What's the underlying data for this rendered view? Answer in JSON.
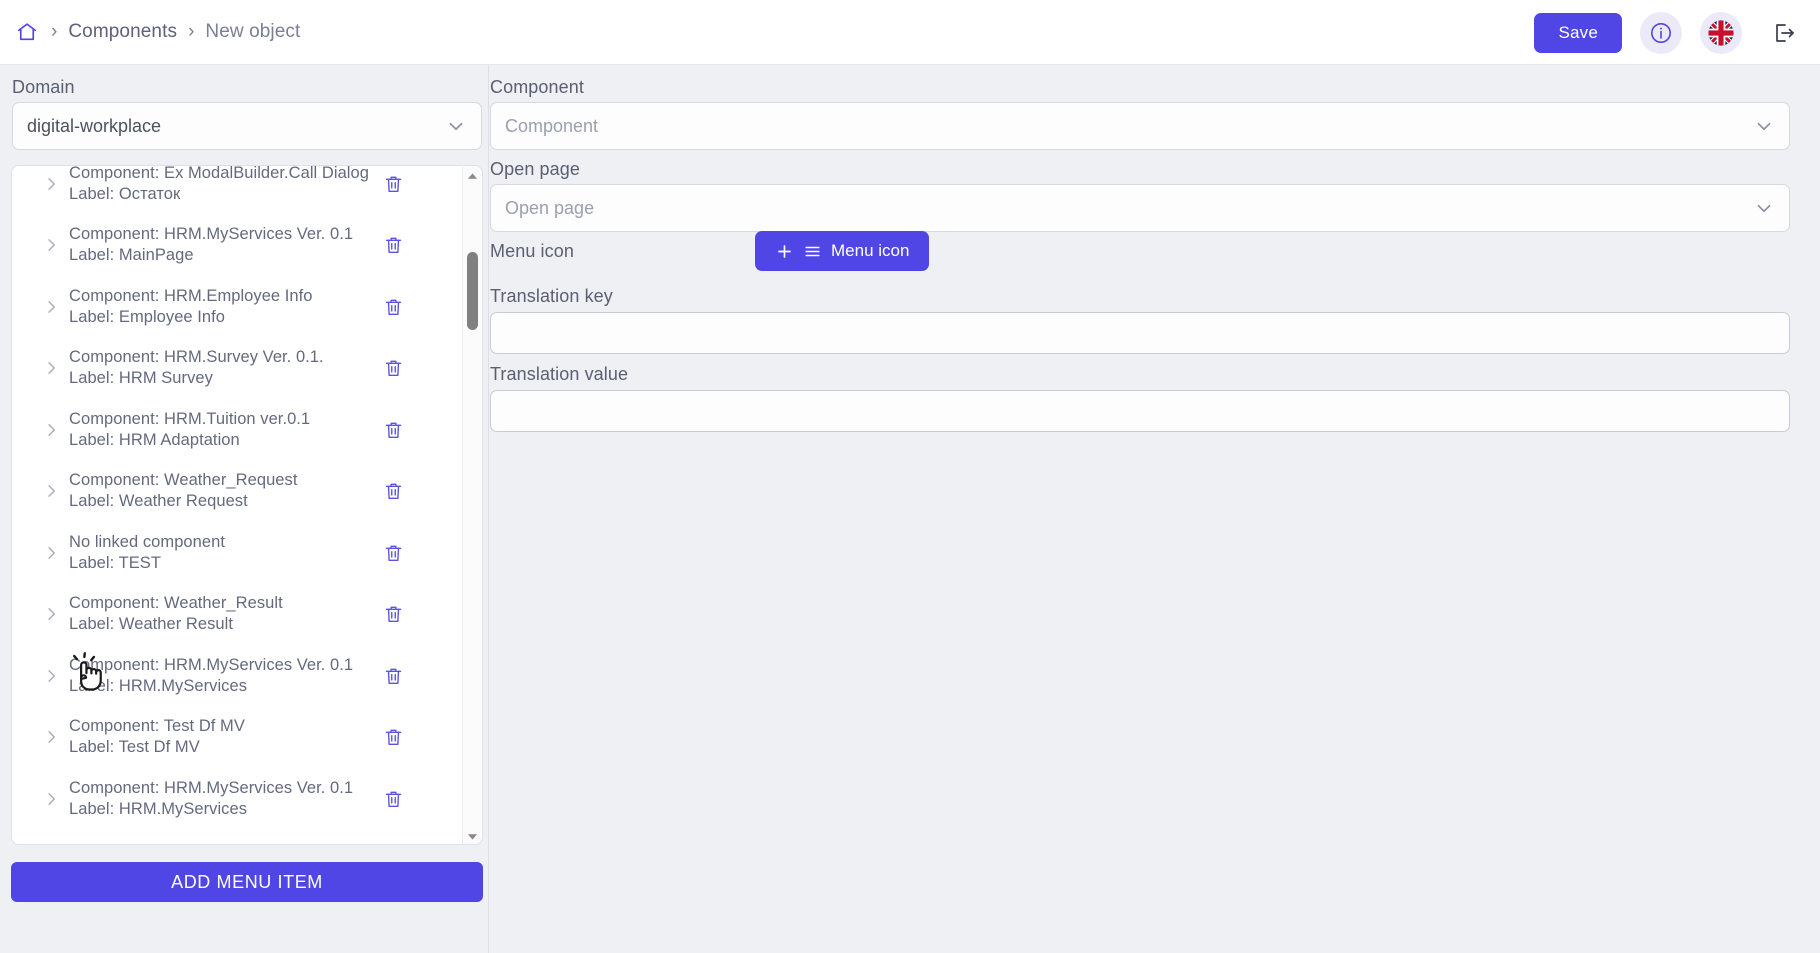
{
  "topbar": {
    "home_icon": "home-icon",
    "separator": "›",
    "breadcrumb": [
      {
        "label": "Components"
      },
      {
        "label": "New object"
      }
    ],
    "save_label": "Save",
    "info_icon": "info-icon",
    "language_icon": "uk-flag-icon",
    "logout_icon": "logout-icon",
    "accent_color": "#4f46e5"
  },
  "left": {
    "domain_label": "Domain",
    "domain_value": "digital-workplace",
    "add_menu_item_label": "ADD MENU ITEM",
    "delete_icon": "trash-icon",
    "expand_icon": "chevron-right-icon",
    "items": [
      {
        "line1": "Component: Ex ModalBuilder.Call Dialog",
        "line2": "Label: Остаток"
      },
      {
        "line1": "Component: HRM.MyServices Ver. 0.1",
        "line2": "Label: MainPage"
      },
      {
        "line1": "Component: HRM.Employee Info",
        "line2": "Label: Employee Info"
      },
      {
        "line1": "Component: HRM.Survey Ver. 0.1.",
        "line2": "Label: HRM Survey"
      },
      {
        "line1": "Component: HRM.Tuition ver.0.1",
        "line2": "Label: HRM Adaptation"
      },
      {
        "line1": "Component: Weather_Request",
        "line2": "Label: Weather Request"
      },
      {
        "line1": "No linked component",
        "line2": "Label: TEST"
      },
      {
        "line1": "Component: Weather_Result",
        "line2": "Label: Weather Result"
      },
      {
        "line1": "Component: HRM.MyServices Ver. 0.1",
        "line2": "Label: HRM.MyServices"
      },
      {
        "line1": "Component: Test Df MV",
        "line2": "Label: Test Df MV"
      },
      {
        "line1": "Component: HRM.MyServices Ver. 0.1",
        "line2": "Label: HRM.MyServices"
      }
    ]
  },
  "right": {
    "component_label": "Component",
    "component_placeholder": "Component",
    "open_page_label": "Open page",
    "open_page_placeholder": "Open page",
    "menu_icon_label": "Menu icon",
    "menu_icon_button_label": "Menu icon",
    "translation_key_label": "Translation key",
    "translation_key_value": "",
    "translation_value_label": "Translation value",
    "translation_value_value": ""
  },
  "cursor": {
    "icon": "pointing-hand-cursor"
  }
}
